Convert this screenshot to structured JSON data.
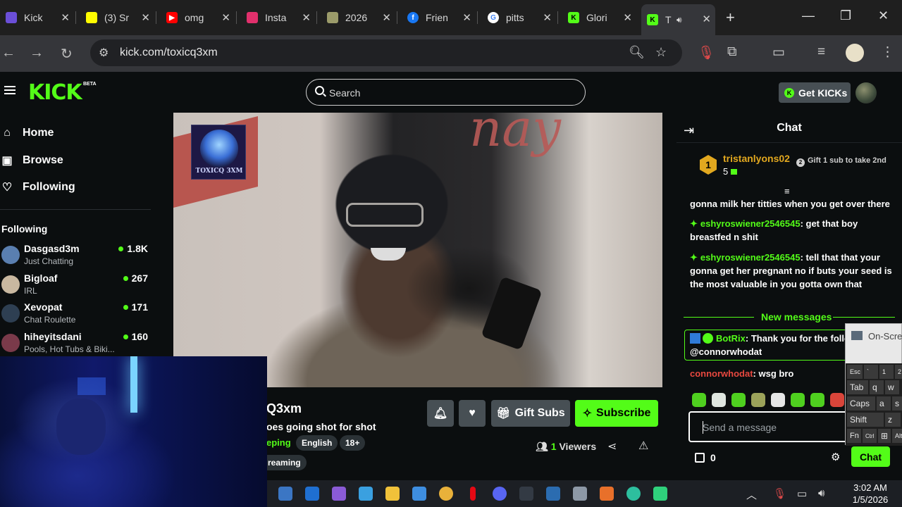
{
  "browser": {
    "tabs": [
      {
        "label": "Kick",
        "favicon": "kick-purple-icon",
        "color": "#6b4fd8",
        "glyph": ""
      },
      {
        "label": "(3) Sr",
        "favicon": "snapchat-icon",
        "color": "#fffc00",
        "glyph": ""
      },
      {
        "label": "omg",
        "favicon": "youtube-icon",
        "color": "#ff0000",
        "glyph": "▶"
      },
      {
        "label": "Insta",
        "favicon": "instagram-icon",
        "color": "#e1306c",
        "glyph": ""
      },
      {
        "label": "2026",
        "favicon": "pinwheel-icon",
        "color": "#9b9b6a",
        "glyph": ""
      },
      {
        "label": "Frien",
        "favicon": "facebook-icon",
        "color": "#1877f2",
        "glyph": "f"
      },
      {
        "label": "pitts",
        "favicon": "google-icon",
        "color": "#ffffff",
        "glyph": "G"
      },
      {
        "label": "Glori",
        "favicon": "kick-green-icon",
        "color": "#53fc18",
        "glyph": "K"
      },
      {
        "label": "T",
        "favicon": "kick-green-icon",
        "color": "#53fc18",
        "glyph": "K",
        "active": true
      }
    ],
    "url": "kick.com/toxicq3xm"
  },
  "kick": {
    "logo": "KICK",
    "logo_badge": "BETA",
    "search_placeholder": "Search",
    "get_kicks": "Get KICKs",
    "kicks_coin": "K",
    "nav": [
      {
        "label": "Home",
        "icon": "home-icon",
        "glyph": "⌂"
      },
      {
        "label": "Browse",
        "icon": "browse-icon",
        "glyph": "▣"
      },
      {
        "label": "Following",
        "icon": "heart-icon",
        "glyph": "♡"
      }
    ],
    "following_title": "Following",
    "following": [
      {
        "name": "Dasgasd3m",
        "category": "Just Chatting",
        "viewers": "1.8K",
        "avatar_color": "#5a7fb0"
      },
      {
        "name": "Bigloaf",
        "category": "IRL",
        "viewers": "267",
        "avatar_color": "#c9b8a0"
      },
      {
        "name": "Xevopat",
        "category": "Chat Roulette",
        "viewers": "171",
        "avatar_color": "#2e3f52"
      },
      {
        "name": "hiheyitsdani",
        "category": "Pools, Hot Tubs & Biki...",
        "viewers": "160",
        "avatar_color": "#7a3a4a"
      }
    ],
    "stream": {
      "overlay_badge": "TOXICQ 3XM",
      "banner_text": "nay",
      "streamer": "Q3xm",
      "title": "oes going shot for shot",
      "category": "eping",
      "tags": [
        "English",
        "18+"
      ],
      "tag_extra": "reaming",
      "gift_subs": "Gift Subs",
      "subscribe": "Subscribe",
      "viewers_count": "1",
      "viewers_label": "Viewers"
    },
    "chat": {
      "title": "Chat",
      "pinned_rank": "1",
      "pinned_user": "tristanlyons02",
      "pinned_count": "5",
      "gift_note": "Gift 1 sub to take 2nd",
      "gift_note_icon": "2",
      "messages": [
        {
          "user": "",
          "text": "gonna milk her titties when you get over there"
        },
        {
          "user": "eshyroswiener2546545",
          "text": ": get that boy breastfed n shit"
        },
        {
          "user": "eshyroswiener2546545",
          "text": ": tell that that your gonna get her pregnant no if buts your seed is the most valuable in you gotta own that"
        }
      ],
      "new_messages": "New messages",
      "bot_user": "BotRix",
      "bot_text": ": Thank you for the follo @connorwhodat",
      "last_user": "connorwhodat",
      "last_text": ": wsg bro",
      "input_placeholder": "Send a message",
      "points": "0",
      "send": "Chat"
    }
  },
  "osk": {
    "title": "On-Scre",
    "rows": [
      [
        "Esc",
        "`",
        "1",
        "2"
      ],
      [
        "Tab",
        "q",
        "w"
      ],
      [
        "Caps",
        "a",
        "s"
      ],
      [
        "Shift",
        "z"
      ],
      [
        "Fn",
        "Ctrl",
        "⊞",
        "Alt"
      ]
    ]
  },
  "taskbar": {
    "time": "3:02 AM",
    "date": "1/5/2026",
    "apps": [
      {
        "name": "steam-icon",
        "color": "#3b76c4"
      },
      {
        "name": "outlook-icon",
        "color": "#1f6fd1"
      },
      {
        "name": "app-purple-icon",
        "color": "#8a5bd6"
      },
      {
        "name": "taskview-icon",
        "color": "#3aa0e0"
      },
      {
        "name": "file-explorer-icon",
        "color": "#f0c23a"
      },
      {
        "name": "store-icon",
        "color": "#3e8ee0"
      },
      {
        "name": "chrome-icon",
        "color": "#e9b13a"
      },
      {
        "name": "netflix-icon",
        "color": "#e50914"
      },
      {
        "name": "discord-icon",
        "color": "#5865f2"
      },
      {
        "name": "app-dark-icon",
        "color": "#333a44"
      },
      {
        "name": "steam2-icon",
        "color": "#2b6cb0"
      },
      {
        "name": "app-gray-icon",
        "color": "#8d98a6"
      },
      {
        "name": "app-orange-icon",
        "color": "#e8702a"
      },
      {
        "name": "edge-icon",
        "color": "#2dbf9e"
      },
      {
        "name": "app-green-icon",
        "color": "#2fd17c"
      }
    ]
  }
}
